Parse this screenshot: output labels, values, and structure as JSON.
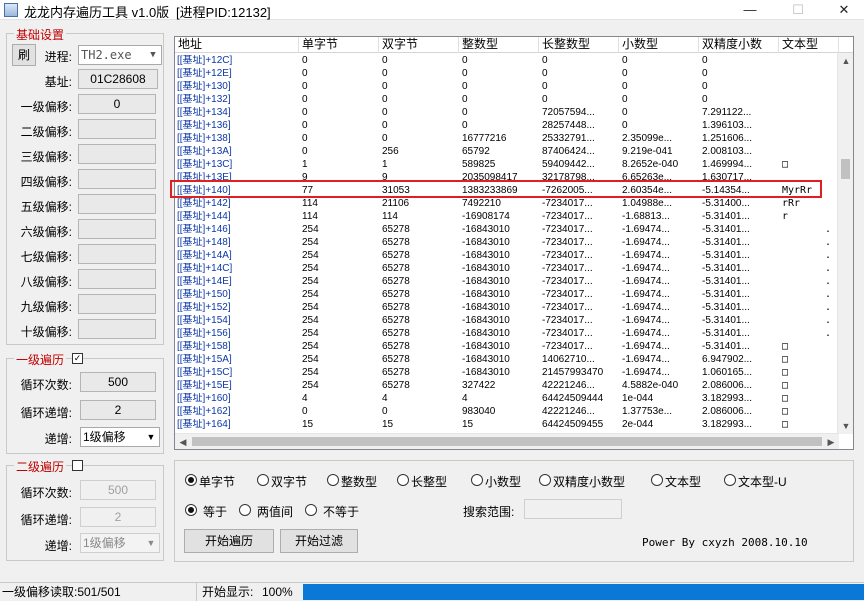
{
  "window": {
    "title": "龙龙内存遍历工具 v1.0版",
    "process_label": "[进程PID:12132]"
  },
  "left": {
    "basic_group_title": "基础设置",
    "refresh_label": "刷",
    "process_field_label": "进程:",
    "process_value": "TH2.exe",
    "base_label": "基址:",
    "base_value": "01C28608",
    "offset_labels": [
      "一级偏移:",
      "二级偏移:",
      "三级偏移:",
      "四级偏移:",
      "五级偏移:",
      "六级偏移:",
      "七级偏移:",
      "八级偏移:",
      "九级偏移:",
      "十级偏移:"
    ],
    "offset_1_value": "0",
    "loop1_title": "一级遍历",
    "loop1_checked": true,
    "loop1_count_label": "循环次数:",
    "loop1_count_value": "500",
    "loop1_step_label": "循环递增:",
    "loop1_step_value": "2",
    "loop1_target_label": "递增:",
    "loop1_target_value": "1级偏移",
    "loop2_title": "二级遍历",
    "loop2_checked": false,
    "loop2_count_label": "循环次数:",
    "loop2_count_value": "500",
    "loop2_step_label": "循环递增:",
    "loop2_step_value": "2",
    "loop2_target_label": "递增:",
    "loop2_target_value": "1级偏移"
  },
  "grid": {
    "columns": [
      "地址",
      "单字节",
      "双字节",
      "整数型",
      "长整数型",
      "小数型",
      "双精度小数",
      "文本型"
    ],
    "rows": [
      [
        "[[基址]+12C]",
        "0",
        "0",
        "0",
        "0",
        "0",
        "0",
        ""
      ],
      [
        "[[基址]+12E]",
        "0",
        "0",
        "0",
        "0",
        "0",
        "0",
        ""
      ],
      [
        "[[基址]+130]",
        "0",
        "0",
        "0",
        "0",
        "0",
        "0",
        ""
      ],
      [
        "[[基址]+132]",
        "0",
        "0",
        "0",
        "0",
        "0",
        "0",
        ""
      ],
      [
        "[[基址]+134]",
        "0",
        "0",
        "0",
        "72057594...",
        "0",
        "7.291122...",
        ""
      ],
      [
        "[[基址]+136]",
        "0",
        "0",
        "0",
        "28257448...",
        "0",
        "1.396103...",
        ""
      ],
      [
        "[[基址]+138]",
        "0",
        "0",
        "16777216",
        "25332791...",
        "2.35099e...",
        "1.251606...",
        ""
      ],
      [
        "[[基址]+13A]",
        "0",
        "256",
        "65792",
        "87406424...",
        "9.219e-041",
        "2.008103...",
        ""
      ],
      [
        "[[基址]+13C]",
        "1",
        "1",
        "589825",
        "59409442...",
        "8.2652e-040",
        "1.469994...",
        "□"
      ],
      [
        "[[基址]+13E]",
        "9",
        "9",
        "2035098417",
        "32178798...",
        "6.65263e...",
        "1.630717...",
        ""
      ],
      [
        "[[基址]+140]",
        "77",
        "31053",
        "1383233869",
        "-7262005...",
        "2.60354e...",
        "-5.14354...",
        "MyrRr"
      ],
      [
        "[[基址]+142]",
        "114",
        "21106",
        "7492210",
        "-7234017...",
        "1.04988e...",
        "-5.31400...",
        "rRr"
      ],
      [
        "[[基址]+144]",
        "114",
        "114",
        "-16908174",
        "-7234017...",
        "-1.68813...",
        "-5.31401...",
        "r"
      ],
      [
        "[[基址]+146]",
        "254",
        "65278",
        "-16843010",
        "-7234017...",
        "-1.69474...",
        "-5.31401...",
        "."
      ],
      [
        "[[基址]+148]",
        "254",
        "65278",
        "-16843010",
        "-7234017...",
        "-1.69474...",
        "-5.31401...",
        "."
      ],
      [
        "[[基址]+14A]",
        "254",
        "65278",
        "-16843010",
        "-7234017...",
        "-1.69474...",
        "-5.31401...",
        "."
      ],
      [
        "[[基址]+14C]",
        "254",
        "65278",
        "-16843010",
        "-7234017...",
        "-1.69474...",
        "-5.31401...",
        "."
      ],
      [
        "[[基址]+14E]",
        "254",
        "65278",
        "-16843010",
        "-7234017...",
        "-1.69474...",
        "-5.31401...",
        "."
      ],
      [
        "[[基址]+150]",
        "254",
        "65278",
        "-16843010",
        "-7234017...",
        "-1.69474...",
        "-5.31401...",
        "."
      ],
      [
        "[[基址]+152]",
        "254",
        "65278",
        "-16843010",
        "-7234017...",
        "-1.69474...",
        "-5.31401...",
        "."
      ],
      [
        "[[基址]+154]",
        "254",
        "65278",
        "-16843010",
        "-7234017...",
        "-1.69474...",
        "-5.31401...",
        "."
      ],
      [
        "[[基址]+156]",
        "254",
        "65278",
        "-16843010",
        "-7234017...",
        "-1.69474...",
        "-5.31401...",
        "."
      ],
      [
        "[[基址]+158]",
        "254",
        "65278",
        "-16843010",
        "-7234017...",
        "-1.69474...",
        "-5.31401...",
        "□"
      ],
      [
        "[[基址]+15A]",
        "254",
        "65278",
        "-16843010",
        "14062710...",
        "-1.69474...",
        "6.947902...",
        "□"
      ],
      [
        "[[基址]+15C]",
        "254",
        "65278",
        "-16843010",
        "21457993470",
        "-1.69474...",
        "1.060165...",
        "□"
      ],
      [
        "[[基址]+15E]",
        "254",
        "65278",
        "327422",
        "42221246...",
        "4.5882e-040",
        "2.086006...",
        "□"
      ],
      [
        "[[基址]+160]",
        "4",
        "4",
        "4",
        "64424509444",
        "1e-044",
        "3.182993...",
        "□"
      ],
      [
        "[[基址]+162]",
        "0",
        "0",
        "983040",
        "42221246...",
        "1.37753e...",
        "2.086006...",
        "□"
      ],
      [
        "[[基址]+164]",
        "15",
        "15",
        "15",
        "64424509455",
        "2e-044",
        "3.182993...",
        "□"
      ]
    ],
    "selected_row": 10
  },
  "panel": {
    "type_options": [
      "单字节",
      "双字节",
      "整数型",
      "长整型",
      "小数型",
      "双精度小数型",
      "文本型",
      "文本型-U"
    ],
    "type_selected": 0,
    "compare_options": [
      "等于",
      "两值间",
      "不等于"
    ],
    "compare_selected": 0,
    "search_range_label": "搜索范围:",
    "search_range_value": "",
    "start_traverse_label": "开始遍历",
    "start_filter_label": "开始过滤",
    "credit": "Power By cxyzh 2008.10.10"
  },
  "status": {
    "read_text": "一级偏移读取:501/501",
    "display_label": "开始显示:",
    "display_percent": "100%",
    "progress": 1.0
  }
}
